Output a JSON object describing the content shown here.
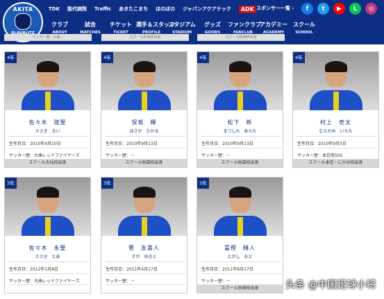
{
  "header": {
    "logo_top": "AKITA",
    "logo_bottom": "BLAUBLITZ",
    "sponsors": [
      "TDK",
      "能代病院",
      "Traffic",
      "あきたこまち",
      "ほのぼの",
      "ジャパンアクアテック",
      "ADK"
    ],
    "sponsor_link": "スポンサー一覧 ›",
    "social": [
      {
        "name": "facebook-icon",
        "glyph": "f",
        "color": "#1877f2"
      },
      {
        "name": "twitter-icon",
        "glyph": "t",
        "color": "#1da1f2"
      },
      {
        "name": "youtube-icon",
        "glyph": "▶",
        "color": "#ff0000"
      },
      {
        "name": "line-icon",
        "glyph": "L",
        "color": "#06c755"
      },
      {
        "name": "instagram-icon",
        "glyph": "◎",
        "color": "#c13584"
      }
    ],
    "nav": [
      {
        "jp": "クラブ",
        "en": "ABOUT"
      },
      {
        "jp": "試合",
        "en": "MATCHES"
      },
      {
        "jp": "チケット",
        "en": "TICKET"
      },
      {
        "jp": "選手＆スタッフ",
        "en": "PROFILE"
      },
      {
        "jp": "スタジアム",
        "en": "STADIUM"
      },
      {
        "jp": "グッズ",
        "en": "GOODS"
      },
      {
        "jp": "ファンクラブ",
        "en": "FANCLUB"
      },
      {
        "jp": "アカデミー",
        "en": "ACADEMY"
      },
      {
        "jp": "スクール",
        "en": "SCHOOL"
      }
    ],
    "strip_texts": [
      "サッカー歴：大館…",
      "スクール秋田校出身",
      "スクール秋田校出身"
    ]
  },
  "players": [
    {
      "grade": "4年",
      "name": "佐々木　琉聖",
      "kana": "ささき　るい",
      "birth": "生年月日：2010年4月10日",
      "history": "サッカー歴：大曲レッドファイヤーズ",
      "school": "スクール大仙校出身"
    },
    {
      "grade": "4年",
      "name": "保坂　輝",
      "kana": "ほさか　ひかる",
      "birth": "生年月日：2010年9月13日",
      "history": "サッカー歴：－",
      "school": "スクール秋田校出身"
    },
    {
      "grade": "4年",
      "name": "松下　新",
      "kana": "まつした　あらた",
      "birth": "生年月日：2010年9月13日",
      "history": "サッカー歴：－",
      "school": "スクール秋田校出身"
    },
    {
      "grade": "4年",
      "name": "村上　壱太",
      "kana": "むらかみ　いちた",
      "birth": "生年月日：2010年9月5日",
      "history": "サッカー歴：本荘南SSS",
      "school": "スクール本荘・にかほ校出身"
    },
    {
      "grade": "3年",
      "name": "佐々木　永聖",
      "kana": "ささき　とあ",
      "birth": "生年月日：2012年1月8日",
      "history": "サッカー歴：大曲レッドファイヤーズ",
      "school": ""
    },
    {
      "grade": "3年",
      "name": "菅　友喜人",
      "kana": "すが　ゆきと",
      "birth": "生年月日：2011年4月17日",
      "history": "サッカー歴：－",
      "school": ""
    },
    {
      "grade": "3年",
      "name": "冨樫　緒人",
      "kana": "とがし　おと",
      "birth": "生年月日：2011年8月17日",
      "history": "サッカー歴：－",
      "school": "スクール秋田校出身"
    }
  ],
  "watermark": "头条 @中国足球小将"
}
